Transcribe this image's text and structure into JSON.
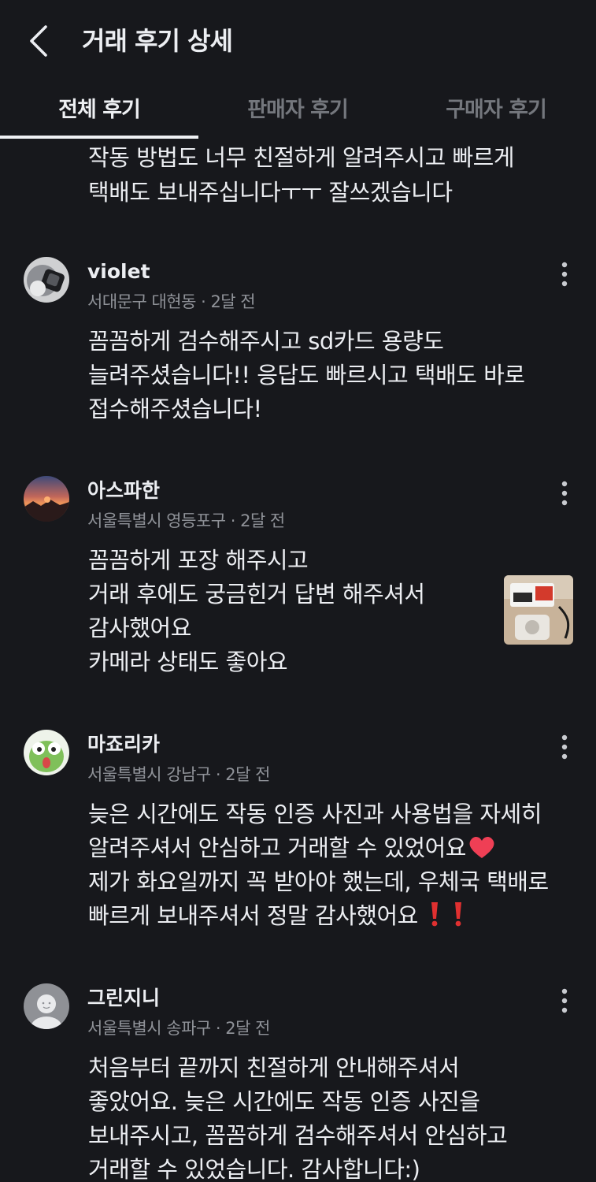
{
  "header": {
    "title": "거래 후기 상세",
    "back_icon": "chevron-left-icon"
  },
  "tabs": [
    {
      "label": "전체 후기",
      "active": true
    },
    {
      "label": "판매자 후기",
      "active": false
    },
    {
      "label": "구매자 후기",
      "active": false
    }
  ],
  "partial_review": {
    "lines": [
      "작동 방법도 너무 친절하게 알려주시고 빠르게",
      "택배도 보내주십니다ㅜㅜ 잘쓰겠습니다"
    ]
  },
  "reviews": [
    {
      "nickname": "violet",
      "meta": "서대문구 대현동 · 2달 전",
      "lines": [
        "꼼꼼하게 검수해주시고 sd카드 용량도",
        "늘려주셨습니다!! 응답도 빠르시고 택배도 바로",
        "접수해주셨습니다!"
      ]
    },
    {
      "nickname": "아스파한",
      "meta": "서울특별시 영등포구 · 2달 전",
      "lines": [
        "꼼꼼하게 포장 해주시고",
        "거래 후에도 궁금힌거 답변 해주셔서",
        "감사했어요",
        "카메라 상태도 좋아요"
      ],
      "has_photo": true
    },
    {
      "nickname": "마죠리카",
      "meta": "서울특별시 강남구 · 2달 전",
      "lines": [
        "늦은 시간에도 작동 인증 사진과 사용법을 자세히",
        "알려주셔서 안심하고 거래할 수 있었어요",
        "제가 화요일까지 꼭 받아야 했는데, 우체국 택배로",
        "빠르게 보내주셔서 정말 감사했어요"
      ],
      "emoji": [
        "heart-emoji",
        "exclamation-emoji"
      ]
    },
    {
      "nickname": "그린지니",
      "meta": "서울특별시 송파구 · 2달 전",
      "lines": [
        "처음부터 끝까지 친절하게 안내해주셔서",
        "좋았어요. 늦은 시간에도 작동 인증 사진을",
        "보내주시고, 꼼꼼하게 검수해주셔서 안심하고",
        "거래할 수 있었습니다. 감사합니다:)"
      ]
    }
  ],
  "colors": {
    "background": "#17181c",
    "text": "#eceef2",
    "muted": "#8f9298",
    "inactive_tab": "#74777d"
  }
}
